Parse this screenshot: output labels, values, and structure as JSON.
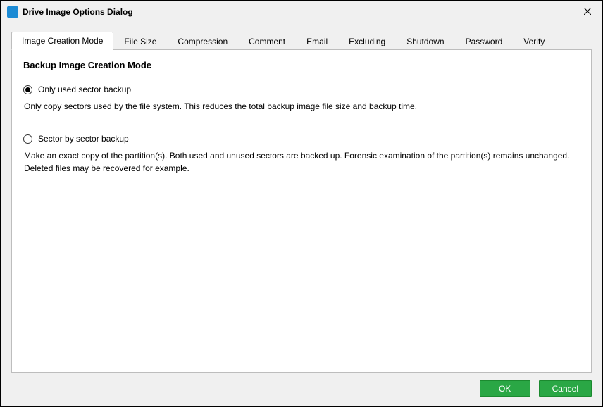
{
  "window": {
    "title": "Drive Image Options Dialog"
  },
  "tabs": [
    {
      "label": "Image Creation Mode",
      "active": true
    },
    {
      "label": "File Size"
    },
    {
      "label": "Compression"
    },
    {
      "label": "Comment"
    },
    {
      "label": "Email"
    },
    {
      "label": "Excluding"
    },
    {
      "label": "Shutdown"
    },
    {
      "label": "Password"
    },
    {
      "label": "Verify"
    }
  ],
  "panel": {
    "heading": "Backup Image Creation Mode",
    "options": [
      {
        "label": "Only used sector backup",
        "selected": true,
        "description": "Only copy sectors used by the file system. This reduces the total backup image file size and backup time."
      },
      {
        "label": "Sector by sector backup",
        "selected": false,
        "description": "Make an exact copy of the partition(s). Both used and unused sectors are backed up. Forensic examination of the partition(s) remains unchanged. Deleted files may be recovered for example."
      }
    ]
  },
  "buttons": {
    "ok": "OK",
    "cancel": "Cancel"
  }
}
